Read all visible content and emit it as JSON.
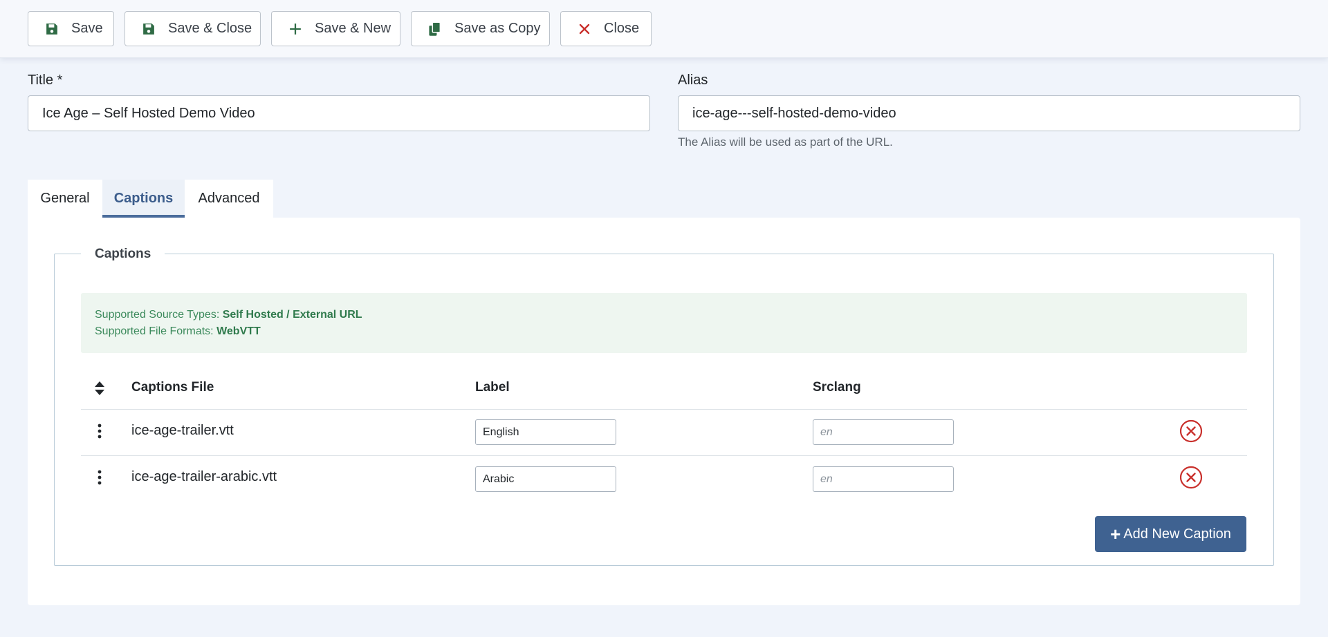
{
  "toolbar": {
    "save": "Save",
    "save_close": "Save & Close",
    "save_new": "Save & New",
    "save_copy": "Save as Copy",
    "close": "Close"
  },
  "title_field": {
    "label": "Title *",
    "value": "Ice Age – Self Hosted Demo Video"
  },
  "alias_field": {
    "label": "Alias",
    "value": "ice-age---self-hosted-demo-video",
    "hint": "The Alias will be used as part of the URL."
  },
  "tabs": [
    {
      "label": "General"
    },
    {
      "label": "Captions"
    },
    {
      "label": "Advanced"
    }
  ],
  "captions": {
    "legend": "Captions",
    "info": {
      "source_label": "Supported Source Types:",
      "source_value": "Self Hosted / External URL",
      "format_label": "Supported File Formats:",
      "format_value": "WebVTT"
    },
    "columns": {
      "file": "Captions File",
      "label": "Label",
      "srclang": "Srclang"
    },
    "rows": [
      {
        "file": "ice-age-trailer.vtt",
        "label": "English",
        "srclang_placeholder": "en"
      },
      {
        "file": "ice-age-trailer-arabic.vtt",
        "label": "Arabic",
        "srclang_placeholder": "en"
      }
    ],
    "add_button": "Add New Caption",
    "add_icon": "+"
  },
  "colors": {
    "accent": "#3f6291",
    "success": "#2f7a4c",
    "danger": "#c9302c"
  }
}
